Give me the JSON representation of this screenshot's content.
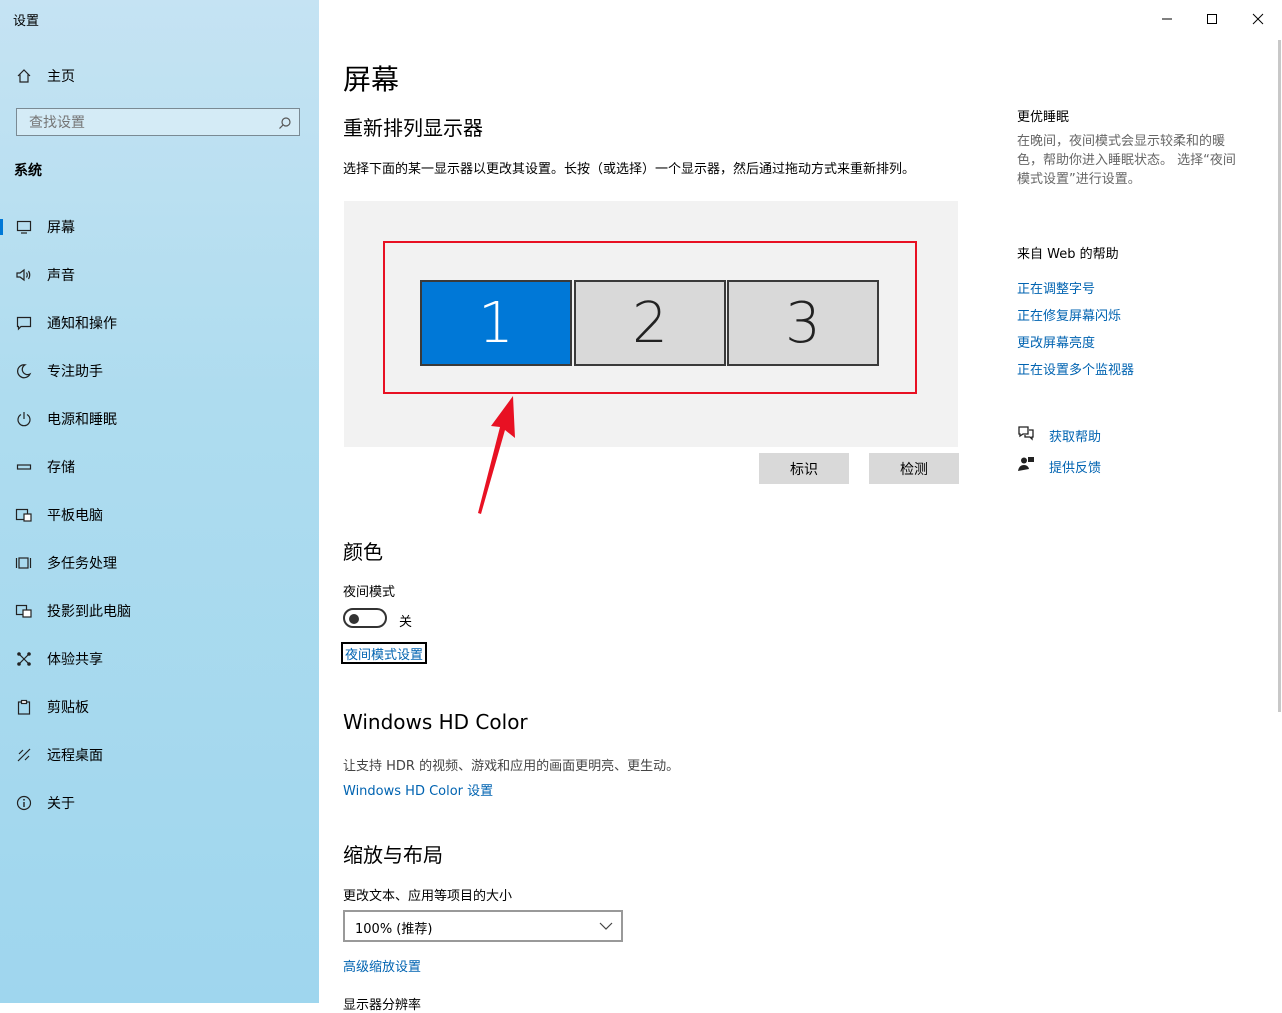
{
  "window": {
    "app_title": "设置"
  },
  "sidebar": {
    "home_label": "主页",
    "search": {
      "placeholder": "查找设置"
    },
    "section_label": "系统",
    "items": [
      {
        "label": "屏幕",
        "icon": "monitor-icon"
      },
      {
        "label": "声音",
        "icon": "speaker-icon"
      },
      {
        "label": "通知和操作",
        "icon": "notification-icon"
      },
      {
        "label": "专注助手",
        "icon": "moon-icon"
      },
      {
        "label": "电源和睡眠",
        "icon": "power-icon"
      },
      {
        "label": "存储",
        "icon": "storage-icon"
      },
      {
        "label": "平板电脑",
        "icon": "tablet-icon"
      },
      {
        "label": "多任务处理",
        "icon": "multitask-icon"
      },
      {
        "label": "投影到此电脑",
        "icon": "project-icon"
      },
      {
        "label": "体验共享",
        "icon": "share-icon"
      },
      {
        "label": "剪贴板",
        "icon": "clipboard-icon"
      },
      {
        "label": "远程桌面",
        "icon": "remote-desktop-icon"
      },
      {
        "label": "关于",
        "icon": "info-icon"
      }
    ]
  },
  "main": {
    "title": "屏幕",
    "arrange": {
      "heading": "重新排列显示器",
      "description": "选择下面的某一显示器以更改其设置。长按（或选择）一个显示器，然后通过拖动方式来重新排列。",
      "monitors": [
        "1",
        "2",
        "3"
      ],
      "identify_label": "标识",
      "detect_label": "检测"
    },
    "color": {
      "heading": "颜色",
      "night_mode_label": "夜间模式",
      "toggle_state": "关",
      "night_settings_link": "夜间模式设置"
    },
    "hdr": {
      "heading": "Windows HD Color",
      "description": "让支持 HDR 的视频、游戏和应用的画面更明亮、更生动。",
      "link": "Windows HD Color 设置"
    },
    "scale": {
      "heading": "缩放与布局",
      "size_label": "更改文本、应用等项目的大小",
      "size_value": "100% (推荐)",
      "advanced_link": "高级缩放设置",
      "resolution_label": "显示器分辨率"
    }
  },
  "right": {
    "sleep_heading": "更优睡眠",
    "sleep_text_lines": [
      "在晚间，夜间模式会显示较柔和的暖",
      "色，帮助你进入睡眠状态。 选择“夜间",
      "模式设置”进行设置。"
    ],
    "web_help_heading": "来自 Web 的帮助",
    "help_links": [
      "正在调整字号",
      "正在修复屏幕闪烁",
      "更改屏幕亮度",
      "正在设置多个监视器"
    ],
    "get_help": "获取帮助",
    "feedback": "提供反馈"
  },
  "colors": {
    "accent": "#0078d7",
    "link": "#0063b1",
    "highlight_box": "#e81123"
  }
}
